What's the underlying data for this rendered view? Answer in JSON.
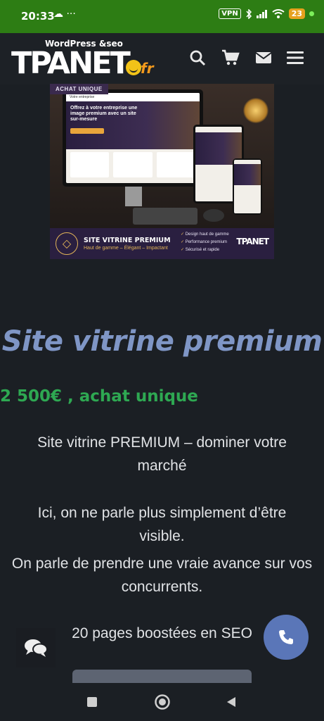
{
  "status_bar": {
    "time": "20:33",
    "left_icons": "☁ ···",
    "vpn": "VPN",
    "battery": "23"
  },
  "header": {
    "logo_subtitle": "WordPress &seo",
    "logo_main": "TPANET",
    "logo_suffix": "fr",
    "icons": [
      "search-icon",
      "cart-icon",
      "mail-icon",
      "menu-icon"
    ]
  },
  "product_image": {
    "badge": "ACHAT UNIQUE",
    "screen_nav": "Votre entreprise",
    "screen_hero": "Offrez à votre entreprise une image premium avec un site sur-mesure",
    "banner_title": "SITE VITRINE PREMIUM",
    "banner_subtitle": "Haut de gamme – Élégant – Impactant",
    "features": [
      "Design haut de gamme",
      "Performance premium",
      "Sécurisé et rapide"
    ],
    "mini_logo": "TPANET"
  },
  "product": {
    "title": "Site vitrine premium",
    "price": "2 500€ , achat unique",
    "description": [
      "Site vitrine PREMIUM – dominer votre marché",
      "Ici, on ne parle plus simplement d’être visible.",
      "On parle de prendre une vraie avance sur vos concurrents.",
      "20 pages boostées en SEO"
    ]
  },
  "colors": {
    "status_bar": "#2d7d14",
    "background": "#1b1f24",
    "title": "#7f96c6",
    "price": "#2ea852",
    "call_button": "#5a76b8"
  }
}
